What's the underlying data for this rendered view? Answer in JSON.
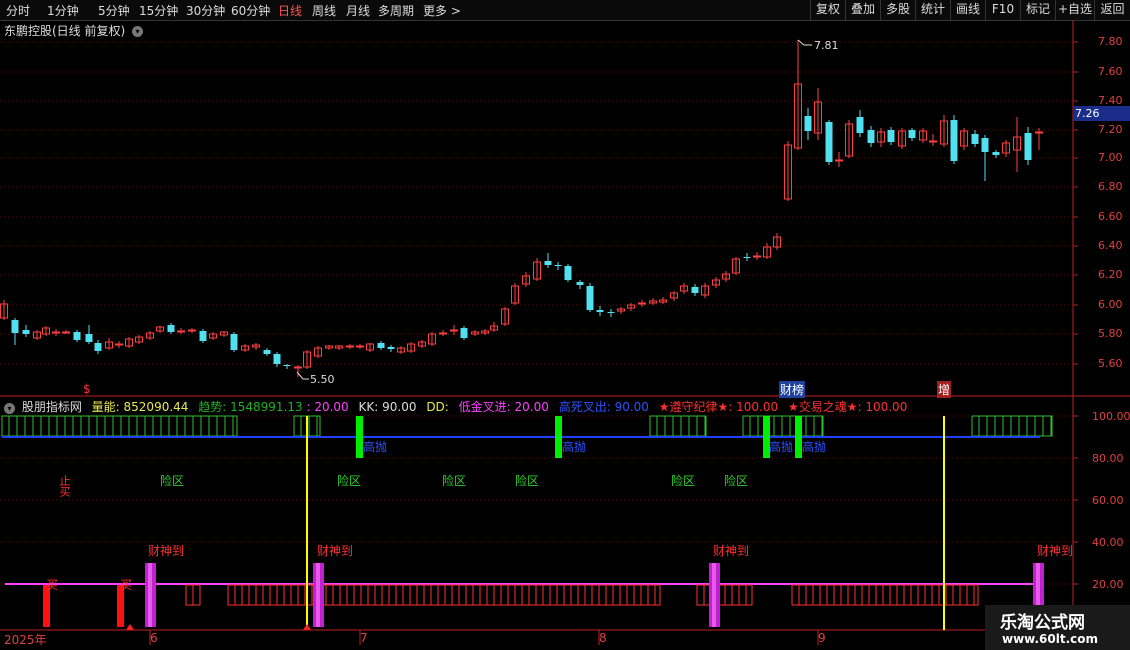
{
  "toolbar": {
    "periods": [
      "分时",
      "1分钟",
      "5分钟",
      "15分钟",
      "30分钟",
      "60分钟",
      "日线",
      "周线",
      "月线",
      "多周期",
      "更多 >"
    ],
    "active_period": "日线",
    "right_buttons": [
      "复权",
      "叠加",
      "多股",
      "统计",
      "画线",
      "F10",
      "标记",
      "+自选",
      "返回"
    ]
  },
  "stock": {
    "title": "东鹏控股(日线 前复权)",
    "current_price": "7.26",
    "high_label": "7.81",
    "low_label": "5.50"
  },
  "price_axis": [
    "7.80",
    "7.60",
    "7.40",
    "7.20",
    "7.00",
    "6.80",
    "6.60",
    "6.40",
    "6.20",
    "6.00",
    "5.80",
    "5.60"
  ],
  "indicator": {
    "name": "股朋指标网",
    "items": [
      {
        "text": "量能: 852090.44",
        "color": "#e8e850"
      },
      {
        "text": "趋势: 1548991.13",
        "color": "#20b020"
      },
      {
        "text": ": 20.00",
        "color": "#ff40ff"
      },
      {
        "text": "KK: 90.00",
        "color": "#dddddd"
      },
      {
        "text": "DD:",
        "color": "#e8e850"
      },
      {
        "text": "低金叉进: 20.00",
        "color": "#ff40ff"
      },
      {
        "text": "高死叉出: 90.00",
        "color": "#3050ff"
      },
      {
        "text": "★遵守纪律★: 100.00",
        "color": "#ff3030"
      },
      {
        "text": "★交易之魂★: 100.00",
        "color": "#ff3030"
      }
    ]
  },
  "indicator_axis": [
    "100.00",
    "80.00",
    "60.00",
    "40.00",
    "20.00"
  ],
  "labels": {
    "caibang": "财榜",
    "zeng": "增",
    "xianqu": "险区",
    "caishen": "财神到",
    "gaopao": "高抛",
    "buy": "买",
    "stop": "止",
    "dollar": "$"
  },
  "dates": [
    "2025年",
    "6",
    "7",
    "8",
    "9"
  ],
  "watermark": {
    "title": "乐淘公式网",
    "url": "www.60lt.com"
  },
  "colors": {
    "up": "#ff4040",
    "down": "#50e0f0",
    "axis": "#c02020"
  }
}
